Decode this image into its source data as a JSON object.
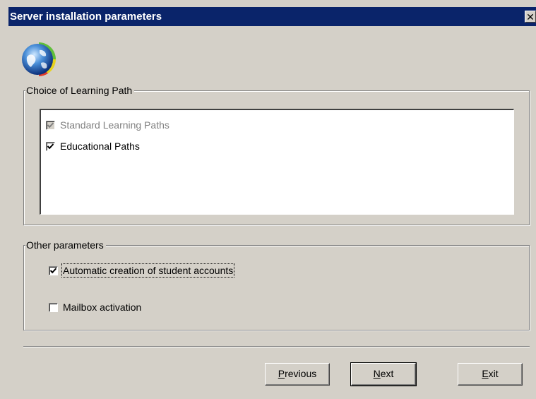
{
  "window": {
    "title": "Server installation parameters",
    "close_glyph": "✕"
  },
  "icon": {
    "name": "globe-icon"
  },
  "learning_path_group": {
    "title": "Choice of Learning Path",
    "items": [
      {
        "label": "Standard Learning Paths",
        "checked": true,
        "disabled": true
      },
      {
        "label": "Educational Paths",
        "checked": true,
        "disabled": false
      }
    ]
  },
  "other_params_group": {
    "title": "Other parameters",
    "items": [
      {
        "label": "Automatic creation of student accounts",
        "checked": true
      },
      {
        "label": "Mailbox activation",
        "checked": false
      }
    ]
  },
  "buttons": {
    "previous": {
      "mnemonic": "P",
      "rest": "revious"
    },
    "next": {
      "mnemonic": "N",
      "rest": "ext"
    },
    "exit": {
      "mnemonic": "E",
      "rest": "xit"
    }
  },
  "colors": {
    "titlebar": "#0a246a",
    "face": "#d4d0c8"
  }
}
